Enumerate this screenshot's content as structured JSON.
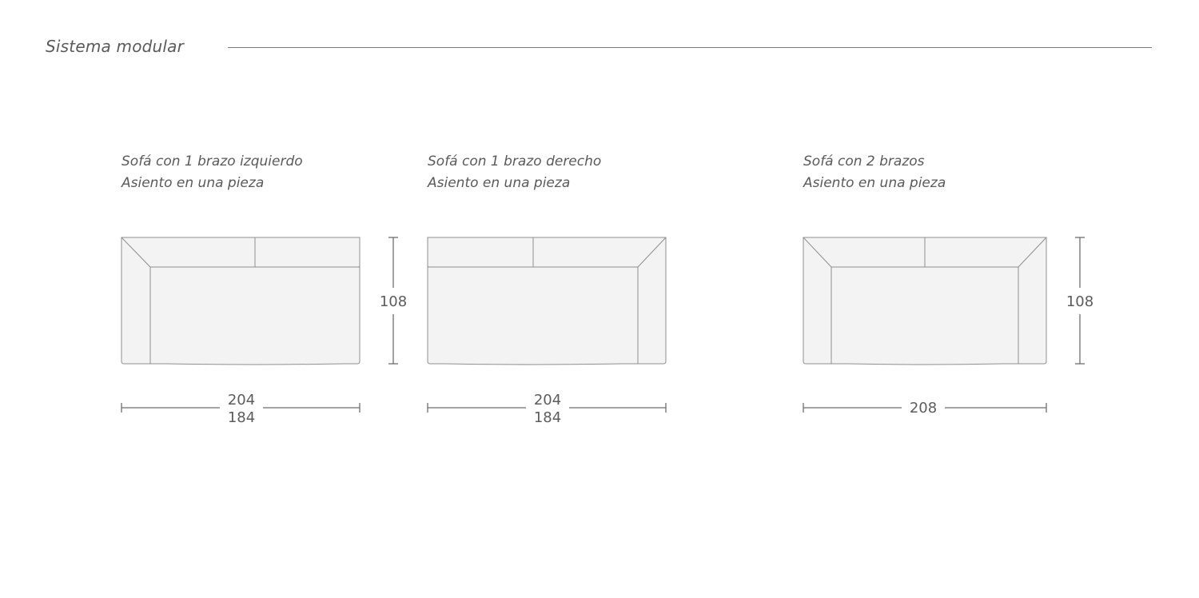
{
  "header": {
    "title": "Sistema modular"
  },
  "modules": [
    {
      "name": "left-arm-sofa",
      "title_line1": "Sofá con 1 brazo izquierdo",
      "title_line2": "Asiento en una pieza",
      "width_labels": [
        "204",
        "184"
      ],
      "height_label": "108"
    },
    {
      "name": "right-arm-sofa",
      "title_line1": "Sofá con 1 brazo derecho",
      "title_line2": "Asiento en una pieza",
      "width_labels": [
        "204",
        "184"
      ],
      "height_label": ""
    },
    {
      "name": "two-arm-sofa",
      "title_line1": "Sofá con 2 brazos",
      "title_line2": "Asiento en una pieza",
      "width_labels": [
        "208"
      ],
      "height_label": "108"
    }
  ],
  "colors": {
    "line": "#8a8a8a",
    "fill": "#f3f3f3",
    "text": "#5c5c5c"
  }
}
